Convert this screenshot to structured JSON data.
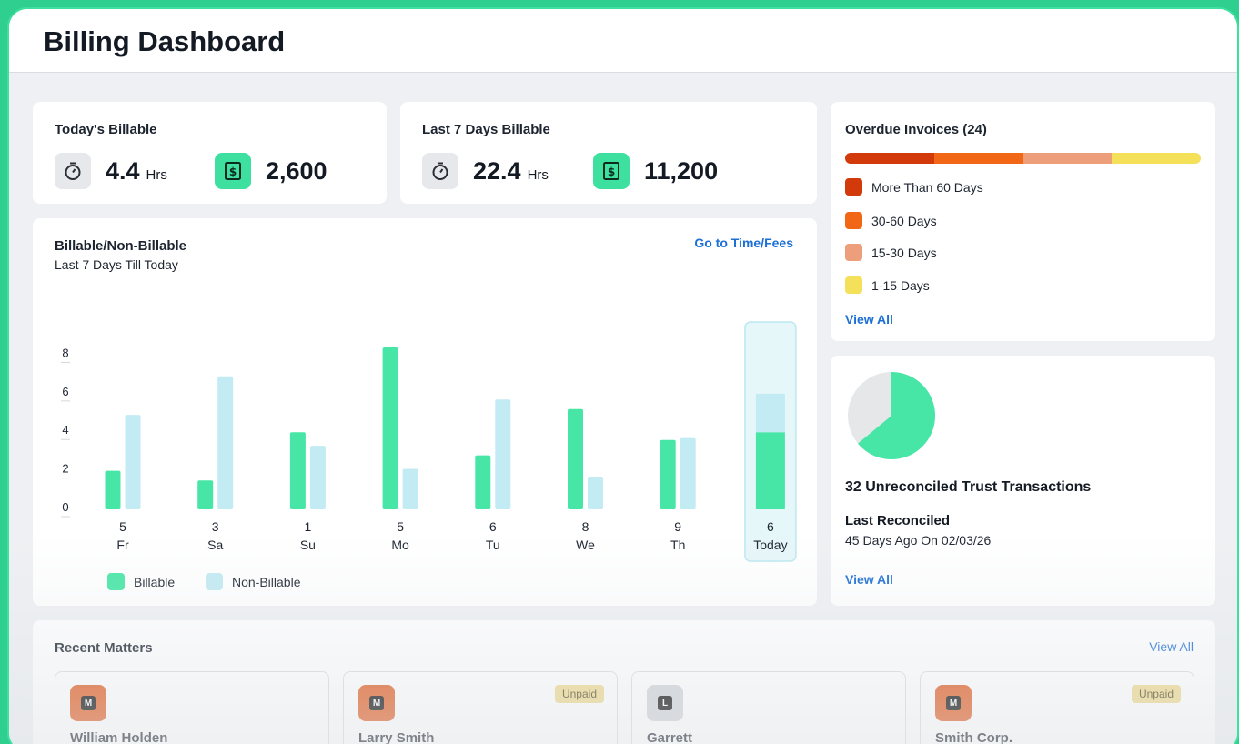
{
  "header": {
    "title": "Billing Dashboard"
  },
  "today": {
    "title": "Today's Billable",
    "hours": "4.4",
    "hours_unit": "Hrs",
    "amount": "2,600"
  },
  "last7": {
    "title": "Last 7 Days Billable",
    "hours": "22.4",
    "hours_unit": "Hrs",
    "amount": "11,200"
  },
  "overdue": {
    "title": "Overdue Invoices (24)",
    "bar_fractions": [
      0.25,
      0.25,
      0.25,
      0.25
    ],
    "legend": [
      {
        "label": "More Than 60 Days",
        "color": "#d23a0c"
      },
      {
        "label": "30-60 Days",
        "color": "#f26716"
      },
      {
        "label": "15-30 Days",
        "color": "#ec9f7a"
      },
      {
        "label": "1-15 Days",
        "color": "#f5e05a"
      }
    ],
    "view_all": "View All"
  },
  "trust": {
    "pie_fraction": 0.64,
    "headline": "32 Unreconciled Trust Transactions",
    "reconciled_label": "Last Reconciled",
    "reconciled_value": "45 Days Ago On 02/03/26",
    "view_all": "View All"
  },
  "billable_chart": {
    "title": "Billable/Non-Billable",
    "subtitle": "Last 7 Days Till Today",
    "link": "Go to Time/Fees",
    "legend_billable": "Billable",
    "legend_non_billable": "Non-Billable"
  },
  "chart_data": {
    "type": "bar",
    "categories": [
      "Fr",
      "Sa",
      "Su",
      "Mo",
      "Tu",
      "We",
      "Th",
      "Today"
    ],
    "counts": [
      "5",
      "3",
      "1",
      "5",
      "6",
      "8",
      "9",
      "6"
    ],
    "series": [
      {
        "name": "Billable",
        "values": [
          2.0,
          1.5,
          4.0,
          8.4,
          2.8,
          5.2,
          3.6,
          4.0
        ]
      },
      {
        "name": "Non-Billable",
        "values": [
          4.9,
          6.9,
          3.3,
          2.1,
          5.7,
          1.7,
          3.7,
          6.0
        ]
      }
    ],
    "yticks": [
      "0",
      "2",
      "4",
      "6",
      "8"
    ],
    "ylim": [
      0,
      8.4
    ],
    "colors": {
      "billable": "#47e6a6",
      "non_billable": "#c3ebf3",
      "highlight_bg": "#e6f7f9",
      "highlight_border": "#bce8f0"
    },
    "highlight_index": 7,
    "legend": "bottom-left"
  },
  "recent": {
    "title": "Recent Matters",
    "view_all": "View All",
    "items": [
      {
        "initial": "M",
        "name": "William Holden",
        "badge": "",
        "color": "#e0581a"
      },
      {
        "initial": "M",
        "name": "Larry Smith",
        "badge": "Unpaid",
        "color": "#e0581a"
      },
      {
        "initial": "L",
        "name": "Garrett",
        "badge": "",
        "color": "#cfd2d6"
      },
      {
        "initial": "M",
        "name": "Smith Corp.",
        "badge": "Unpaid",
        "color": "#e0581a"
      }
    ]
  }
}
